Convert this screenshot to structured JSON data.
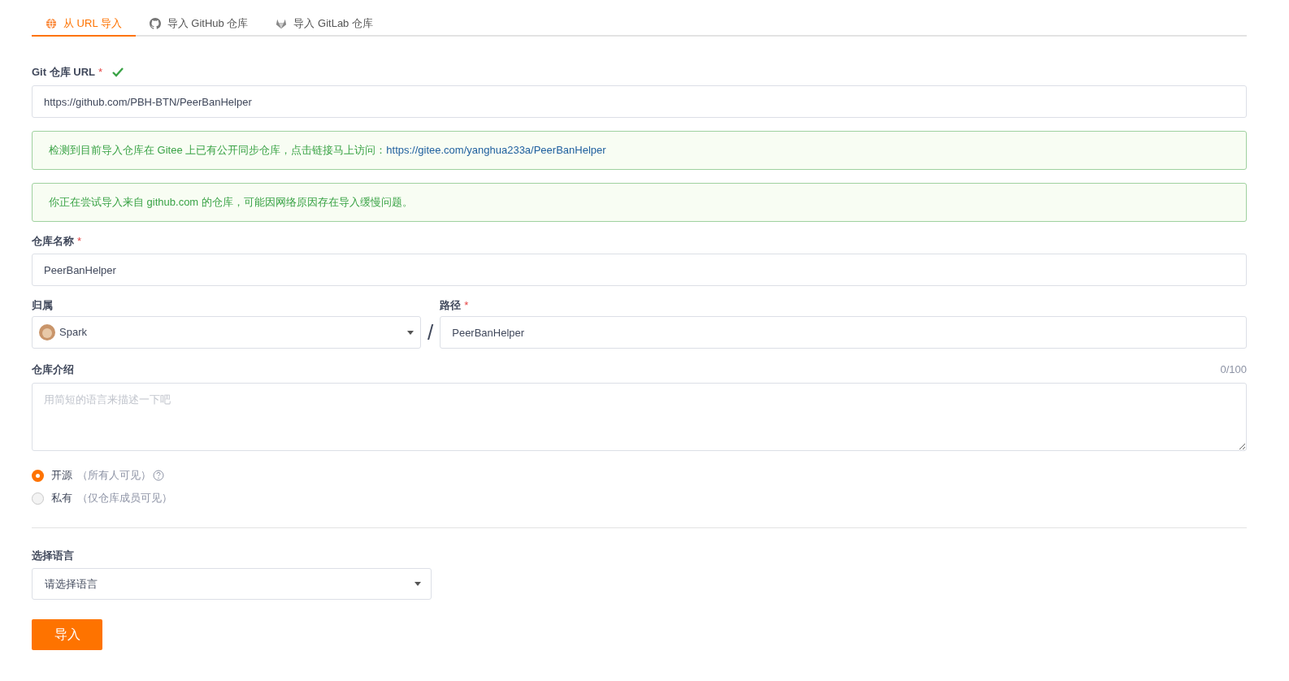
{
  "tabs": [
    {
      "label": "从 URL 导入",
      "kind": "globe",
      "selected": true
    },
    {
      "label": "导入 GitHub 仓库",
      "kind": "github",
      "selected": false
    },
    {
      "label": "导入 GitLab 仓库",
      "kind": "gitlab",
      "selected": false
    }
  ],
  "url_field": {
    "label": "Git 仓库 URL",
    "required_mark": "*",
    "valid": true,
    "value": "https://github.com/PBH-BTN/PeerBanHelper"
  },
  "alerts": [
    {
      "text": "检测到目前导入仓库在 Gitee 上已有公开同步仓库，点击链接马上访问：",
      "link": "https://gitee.com/yanghua233a/PeerBanHelper"
    },
    {
      "text": "你正在尝试导入来自 github.com 的仓库，可能因网络原因存在导入缓慢问题。"
    }
  ],
  "name_field": {
    "label": "仓库名称",
    "required_mark": "*",
    "value": "PeerBanHelper"
  },
  "owner_field": {
    "label": "归属",
    "value": "Spark"
  },
  "separator": "/",
  "path_field": {
    "label": "路径",
    "required_mark": "*",
    "value": "PeerBanHelper"
  },
  "description_field": {
    "label": "仓库介绍",
    "counter": "0/100",
    "placeholder": "用简短的语言来描述一下吧"
  },
  "visibility": [
    {
      "label": "开源",
      "hint": "（所有人可见）",
      "help": true,
      "selected": true
    },
    {
      "label": "私有",
      "hint": "（仅仓库成员可见）",
      "help": false,
      "selected": false
    }
  ],
  "language_field": {
    "label": "选择语言",
    "placeholder": "请选择语言"
  },
  "submit_button": "导入"
}
